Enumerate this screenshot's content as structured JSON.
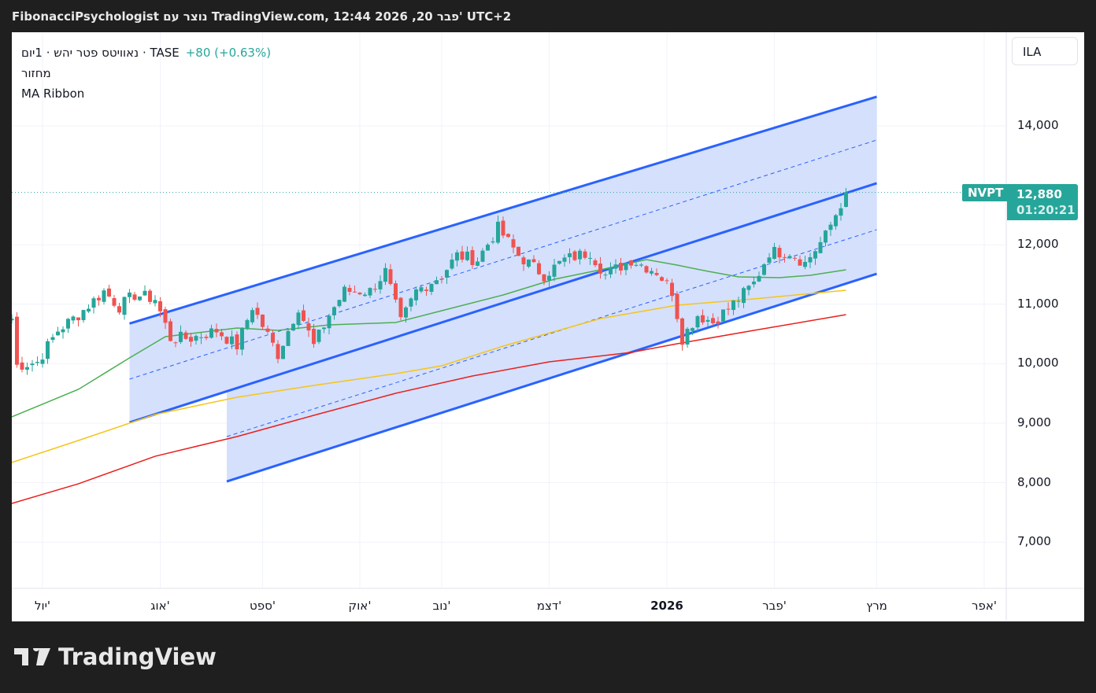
{
  "header": {
    "title": "FibonacciPsychologist נוצר עם TradingView.com, 12:44 2026 ,20 פבר' UTC+2"
  },
  "legend": {
    "symbol": "נאוויטס פטר יהש · 1יום · TASE",
    "change": "+80 (+0.63%)",
    "indicator1": "מחזור",
    "indicator2": "MA Ribbon"
  },
  "currency": "ILA",
  "price_label": {
    "ticker": "NVPT",
    "price": "12,880",
    "countdown": "01:20:21"
  },
  "brand": "TradingView",
  "colors": {
    "up": "#26a69a",
    "down": "#ef5350",
    "channel": "#2962ff",
    "fill": "#d3defc",
    "ma_fast": "#4caf50",
    "ma_mid": "#f5c518",
    "ma_slow": "#e8201c"
  },
  "chart_data": {
    "type": "candlestick",
    "ylim": [
      6250,
      15600
    ],
    "x_unit": "bar index (daily)",
    "xlim": [
      0,
      194
    ],
    "y_ticks": [
      {
        "v": 7000,
        "label": "7,000"
      },
      {
        "v": 8000,
        "label": "8,000"
      },
      {
        "v": 9000,
        "label": "9,000"
      },
      {
        "v": 10000,
        "label": "10,000"
      },
      {
        "v": 11000,
        "label": "11,000"
      },
      {
        "v": 12000,
        "label": "12,000"
      },
      {
        "v": 14000,
        "label": "14,000"
      }
    ],
    "x_ticks": [
      {
        "i": 6,
        "label": "יול'"
      },
      {
        "i": 29,
        "label": "אוג'"
      },
      {
        "i": 49,
        "label": "ספט'"
      },
      {
        "i": 68,
        "label": "אוק'"
      },
      {
        "i": 84,
        "label": "נוב'"
      },
      {
        "i": 105,
        "label": "דצמ'"
      },
      {
        "i": 128,
        "label": "2026",
        "bold": true
      },
      {
        "i": 149,
        "label": "פבר'"
      },
      {
        "i": 169,
        "label": "מרץ"
      },
      {
        "i": 190,
        "label": "אפר'"
      }
    ],
    "last_price": 12880,
    "closes_key": [
      [
        0,
        10760
      ],
      [
        1,
        9970
      ],
      [
        5,
        10030
      ],
      [
        9,
        10560
      ],
      [
        13,
        10825
      ],
      [
        18,
        11220
      ],
      [
        21,
        10960
      ],
      [
        24,
        11160
      ],
      [
        28,
        11090
      ],
      [
        31,
        10430
      ],
      [
        35,
        10430
      ],
      [
        40,
        10560
      ],
      [
        44,
        10300
      ],
      [
        47,
        10960
      ],
      [
        52,
        10160
      ],
      [
        56,
        10960
      ],
      [
        59,
        10300
      ],
      [
        62,
        10820
      ],
      [
        65,
        11220
      ],
      [
        70,
        11220
      ],
      [
        73,
        11550
      ],
      [
        76,
        10690
      ],
      [
        79,
        11220
      ],
      [
        84,
        11490
      ],
      [
        87,
        11820
      ],
      [
        91,
        11750
      ],
      [
        95,
        12280
      ],
      [
        99,
        11820
      ],
      [
        104,
        11490
      ],
      [
        108,
        11750
      ],
      [
        113,
        11880
      ],
      [
        116,
        11490
      ],
      [
        121,
        11750
      ],
      [
        126,
        11550
      ],
      [
        129,
        11220
      ],
      [
        131,
        10430
      ],
      [
        134,
        10820
      ],
      [
        137,
        10700
      ],
      [
        142,
        11090
      ],
      [
        145,
        11350
      ],
      [
        148,
        11880
      ],
      [
        152,
        11880
      ],
      [
        155,
        11690
      ],
      [
        159,
        12150
      ],
      [
        163,
        12880
      ]
    ],
    "ma_fast": [
      [
        0,
        9106
      ],
      [
        13,
        9569
      ],
      [
        23,
        10098
      ],
      [
        30,
        10455
      ],
      [
        44,
        10601
      ],
      [
        52,
        10561
      ],
      [
        62,
        10653
      ],
      [
        75,
        10693
      ],
      [
        84,
        10892
      ],
      [
        96,
        11156
      ],
      [
        106,
        11421
      ],
      [
        115,
        11579
      ],
      [
        124,
        11751
      ],
      [
        130,
        11659
      ],
      [
        136,
        11554
      ],
      [
        142,
        11461
      ],
      [
        150,
        11447
      ],
      [
        156,
        11487
      ],
      [
        163,
        11579
      ]
    ],
    "ma_mid": [
      [
        0,
        8339
      ],
      [
        13,
        8709
      ],
      [
        28,
        9146
      ],
      [
        44,
        9437
      ],
      [
        59,
        9635
      ],
      [
        75,
        9833
      ],
      [
        84,
        9966
      ],
      [
        96,
        10296
      ],
      [
        115,
        10759
      ],
      [
        130,
        10984
      ],
      [
        145,
        11090
      ],
      [
        163,
        11235
      ]
    ],
    "ma_slow": [
      [
        0,
        7651
      ],
      [
        13,
        7981
      ],
      [
        28,
        8444
      ],
      [
        44,
        8775
      ],
      [
        59,
        9132
      ],
      [
        75,
        9503
      ],
      [
        90,
        9794
      ],
      [
        105,
        10032
      ],
      [
        121,
        10190
      ],
      [
        130,
        10336
      ],
      [
        145,
        10561
      ],
      [
        163,
        10825
      ]
    ],
    "channel": {
      "upper": [
        [
          23,
          10675
        ],
        [
          169,
          14490
        ]
      ],
      "middle": [
        [
          23,
          9013
        ],
        [
          169,
          13035
        ]
      ],
      "lower": [
        [
          42,
          8021
        ],
        [
          169,
          11513
        ]
      ],
      "dash_upper": [
        [
          23,
          9741
        ],
        [
          169,
          13762
        ]
      ],
      "dash_lower": [
        [
          42,
          8775
        ],
        [
          169,
          12254
        ]
      ]
    }
  }
}
